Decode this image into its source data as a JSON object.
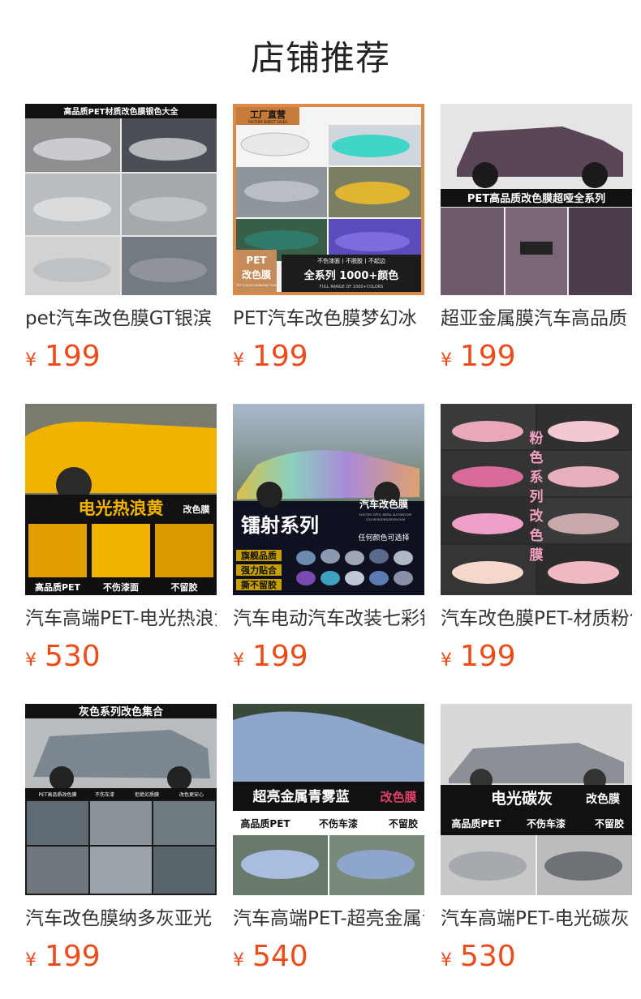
{
  "page": {
    "title": "店铺推荐"
  },
  "currency": "¥",
  "products": [
    {
      "name": "pet汽车改色膜GT银滨",
      "price": "199",
      "overlay": [
        "高品质PET材质改色膜银色大全"
      ],
      "colors": [
        "#9da3a8",
        "#7f858b",
        "#c6c9cc"
      ]
    },
    {
      "name": "PET汽车改色膜梦幻冰",
      "price": "199",
      "overlay": [
        "工厂直营",
        "FACTORY DIRECT SALES",
        "PET",
        "改色膜",
        "PET COLOR CHANGING FILM",
        "不伤漆面丨不脱胶丨不起边",
        "全系列 1000+颜色",
        "FULL RANGE OF 1000+COLORS"
      ],
      "colors": [
        "#3fd6c8",
        "#e0b532",
        "#6a5acd"
      ]
    },
    {
      "name": "超亚金属膜汽车高品质",
      "price": "199",
      "overlay": [
        "PET高品质改色膜超哑全系列"
      ],
      "colors": [
        "#5a4657",
        "#7b6678",
        "#3b2e3a"
      ]
    },
    {
      "name": "汽车高端PET-电光热浪黄",
      "price": "530",
      "overlay": [
        "电光热浪黄",
        "改色膜",
        "高品质PET",
        "不伤漆面",
        "不留胶"
      ],
      "colors": [
        "#f2b300",
        "#e29e00",
        "#1a1a1a"
      ]
    },
    {
      "name": "汽车电动汽车改装七彩镭射",
      "price": "199",
      "overlay": [
        "镭射系列",
        "汽车改色膜",
        "ELECTRO OPTIC METAL AUTOMOTIVE",
        "COLOR MODIFICATION FILM",
        "任何颜色可选择",
        "旗舰品质",
        "强力贴合",
        "撕不留胶"
      ],
      "colors": [
        "#8aa0c0",
        "#c08ad0",
        "#0f1020"
      ]
    },
    {
      "name": "汽车改色膜PET-材质粉色",
      "price": "199",
      "overlay": [
        "粉",
        "色",
        "系",
        "列",
        "改",
        "色",
        "膜"
      ],
      "colors": [
        "#e8a8b8",
        "#f4c8d0",
        "#d88ca4"
      ]
    },
    {
      "name": "汽车改色膜纳多灰亚光",
      "price": "199",
      "overlay": [
        "灰色系列改色集合",
        "PET高品质改色膜",
        "不伤车漆",
        "拒绝劣质膜",
        "改色更安心"
      ],
      "colors": [
        "#7c8790",
        "#5f6a72",
        "#9aa3aa"
      ]
    },
    {
      "name": "汽车高端PET-超亮金属青雾蓝",
      "price": "540",
      "overlay": [
        "超亮金属青雾蓝",
        "改色膜",
        "高品质PET",
        "不伤车漆",
        "不留胶"
      ],
      "colors": [
        "#8ea6cc",
        "#a9bde0",
        "#5f7396"
      ]
    },
    {
      "name": "汽车高端PET-电光碳灰",
      "price": "530",
      "overlay": [
        "电光碳灰",
        "改色膜",
        "高品质PET",
        "不伤车漆",
        "不留胶"
      ],
      "colors": [
        "#8c9096",
        "#a6a9ae",
        "#6e7277"
      ]
    }
  ]
}
